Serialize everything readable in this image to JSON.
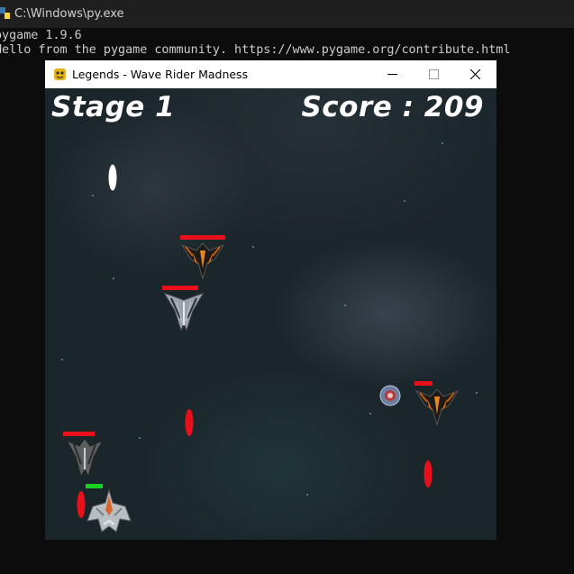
{
  "console": {
    "title": "C:\\Windows\\py.exe",
    "lines": [
      "pygame 1.9.6",
      "Hello from the pygame community. https://www.pygame.org/contribute.html"
    ]
  },
  "game_window": {
    "title": "Legends - Wave Rider Madness",
    "hud": {
      "stage": "Stage 1",
      "score": "Score : 209"
    },
    "colors": {
      "health_enemy": "#e8101a",
      "health_player": "#19d21f",
      "laser_enemy": "#e8101a",
      "laser_player": "#ffffff",
      "hud_text": "#ffffff"
    },
    "enemy_health": [
      1.0,
      1.0,
      0.5,
      1.0
    ],
    "player_health": 1.0
  }
}
